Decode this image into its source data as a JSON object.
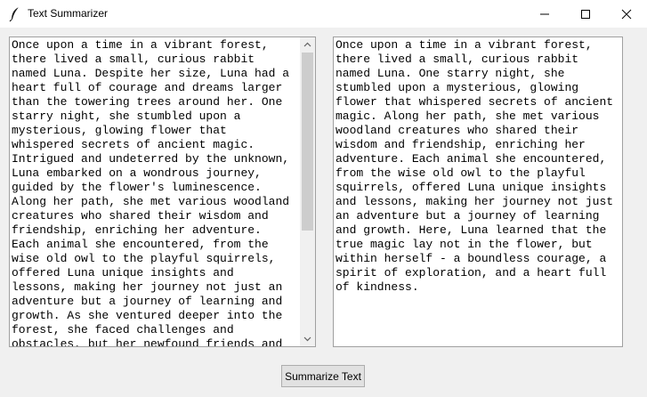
{
  "window": {
    "title": "Text Summarizer"
  },
  "input_text": "Once upon a time in a vibrant forest,\nthere lived a small, curious rabbit\nnamed Luna. Despite her size, Luna had a\nheart full of courage and dreams larger\nthan the towering trees around her. One\nstarry night, she stumbled upon a\nmysterious, glowing flower that\nwhispered secrets of ancient magic.\nIntrigued and undeterred by the unknown,\nLuna embarked on a wondrous journey,\nguided by the flower's luminescence.\nAlong her path, she met various woodland\ncreatures who shared their wisdom and\nfriendship, enriching her adventure.\nEach animal she encountered, from the\nwise old owl to the playful squirrels,\noffered Luna unique insights and\nlessons, making her journey not just an\nadventure but a journey of learning and\ngrowth. As she ventured deeper into the\nforest, she faced challenges and\nobstacles, but her newfound friends and",
  "summary_text": "Once upon a time in a vibrant forest,\nthere lived a small, curious rabbit\nnamed Luna. One starry night, she\nstumbled upon a mysterious, glowing\nflower that whispered secrets of ancient\nmagic. Along her path, she met various\nwoodland creatures who shared their\nwisdom and friendship, enriching her\nadventure. Each animal she encountered,\nfrom the wise old owl to the playful\nsquirrels, offered Luna unique insights\nand lessons, making her journey not just\nan adventure but a journey of learning\nand growth. Here, Luna learned that the\ntrue magic lay not in the flower, but\nwithin herself - a boundless courage, a\nspirit of exploration, and a heart full\nof kindness.",
  "button": {
    "label": "Summarize Text"
  },
  "icons": {
    "app": "feather-icon",
    "minimize": "minimize-icon",
    "maximize": "maximize-icon",
    "close": "close-icon",
    "scroll_up": "chevron-up-icon",
    "scroll_down": "chevron-down-icon"
  },
  "colors": {
    "window_bg": "#f0f0f0",
    "titlebar_bg": "#ffffff",
    "text_bg": "#ffffff",
    "button_bg": "#e1e1e1",
    "scroll_thumb": "#cdcdcd"
  }
}
